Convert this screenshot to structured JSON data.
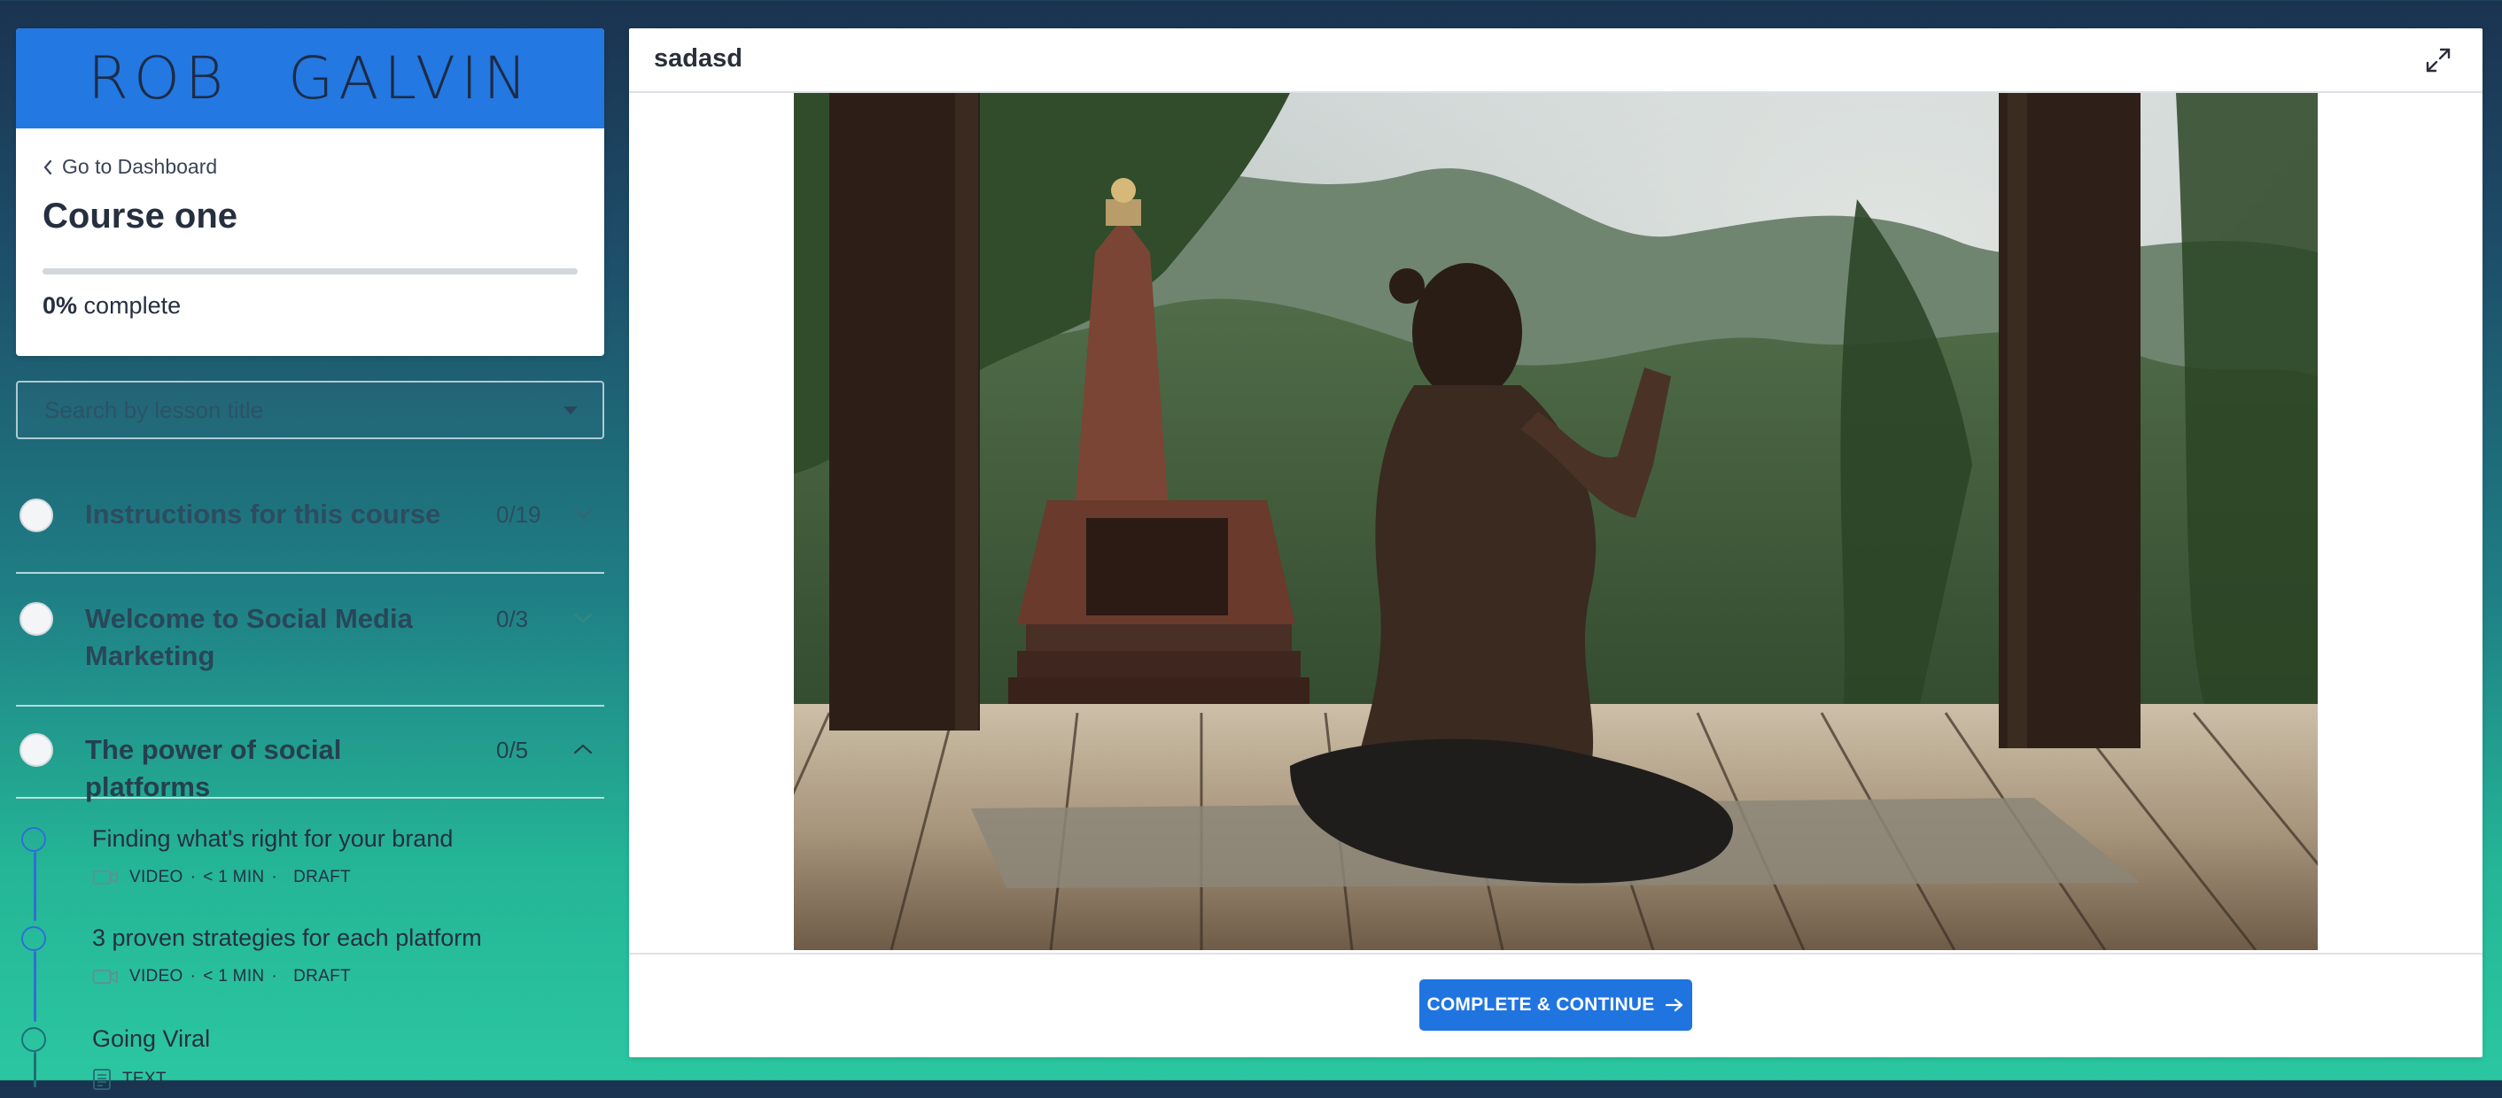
{
  "brand": {
    "logo_text": "ROB GALVIN",
    "color": "#2378e2"
  },
  "course": {
    "back_label": "Go to Dashboard",
    "title": "Course one",
    "progress_fraction": 0.0,
    "progress_percent": "0%",
    "progress_suffix": "complete"
  },
  "search": {
    "placeholder": "Search by lesson title"
  },
  "chapters": [
    {
      "title": "Instructions for this course",
      "count": "0/19",
      "expanded": false
    },
    {
      "title": "Welcome to Social Media Marketing",
      "count": "0/3",
      "expanded": false
    },
    {
      "title": "The power of social platforms",
      "count": "0/5",
      "expanded": true
    }
  ],
  "lessons": [
    {
      "title": "Finding what's right for your brand",
      "icon": "video-icon",
      "type": "VIDEO",
      "duration": "< 1 MIN",
      "status": "DRAFT"
    },
    {
      "title": "3 proven strategies for each platform",
      "icon": "video-icon",
      "type": "VIDEO",
      "duration": "< 1 MIN",
      "status": "DRAFT"
    },
    {
      "title": "Going Viral",
      "icon": "text-document-icon",
      "type": "TEXT"
    }
  ],
  "player": {
    "lesson_name": "sadasd",
    "expand_icon": "expand-icon",
    "media_description_icon": "video-frame"
  },
  "cta": {
    "label": "COMPLETE & CONTINUE",
    "icon": "arrow-right-icon",
    "color": "#1f74e0"
  }
}
